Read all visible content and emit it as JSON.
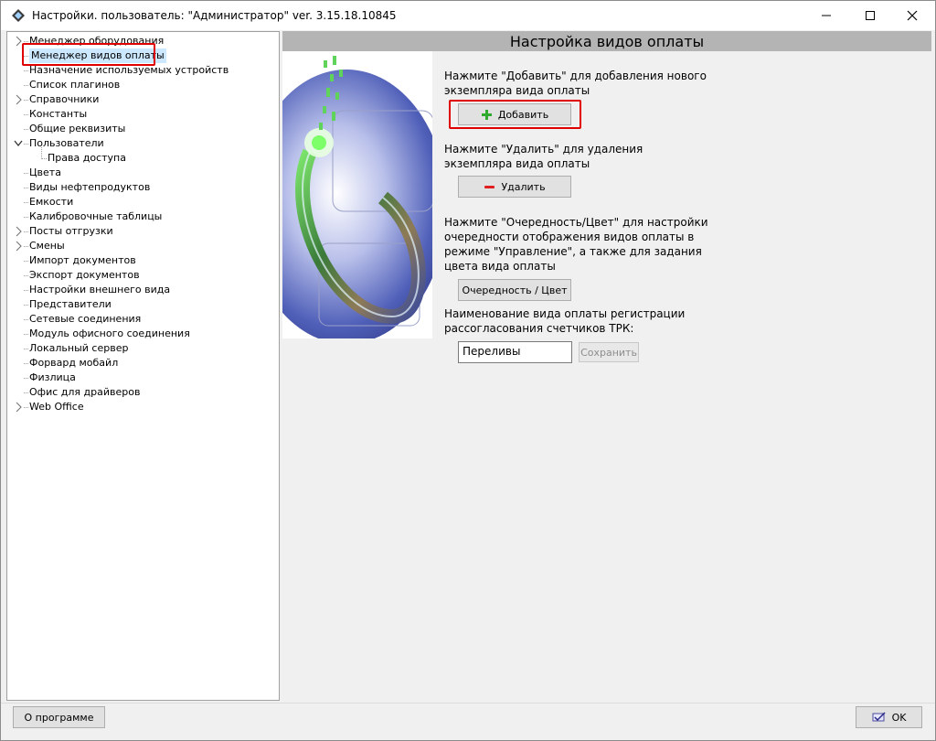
{
  "window": {
    "title": "Настройки. пользователь: \"Администратор\" ver. 3.15.18.10845"
  },
  "tree": {
    "items": [
      {
        "label": "Менеджер оборудования",
        "expandable": true,
        "expanded": false,
        "level": 0
      },
      {
        "label": "Менеджер видов оплаты",
        "expandable": false,
        "level": 0,
        "selected": true
      },
      {
        "label": "Назначение используемых устройств",
        "expandable": false,
        "level": 0
      },
      {
        "label": "Список плагинов",
        "expandable": false,
        "level": 0
      },
      {
        "label": "Справочники",
        "expandable": true,
        "expanded": false,
        "level": 0
      },
      {
        "label": "Константы",
        "expandable": false,
        "level": 0
      },
      {
        "label": "Общие реквизиты",
        "expandable": false,
        "level": 0
      },
      {
        "label": "Пользователи",
        "expandable": true,
        "expanded": true,
        "level": 0
      },
      {
        "label": "Права доступа",
        "expandable": false,
        "level": 1
      },
      {
        "label": "Цвета",
        "expandable": false,
        "level": 0
      },
      {
        "label": "Виды нефтепродуктов",
        "expandable": false,
        "level": 0
      },
      {
        "label": "Емкости",
        "expandable": false,
        "level": 0
      },
      {
        "label": "Калибровочные таблицы",
        "expandable": false,
        "level": 0
      },
      {
        "label": "Посты отгрузки",
        "expandable": true,
        "expanded": false,
        "level": 0
      },
      {
        "label": "Смены",
        "expandable": true,
        "expanded": false,
        "level": 0
      },
      {
        "label": "Импорт документов",
        "expandable": false,
        "level": 0
      },
      {
        "label": "Экспорт документов",
        "expandable": false,
        "level": 0
      },
      {
        "label": "Настройки внешнего вида",
        "expandable": false,
        "level": 0
      },
      {
        "label": "Представители",
        "expandable": false,
        "level": 0
      },
      {
        "label": "Сетевые соединения",
        "expandable": false,
        "level": 0
      },
      {
        "label": "Модуль офисного соединения",
        "expandable": false,
        "level": 0
      },
      {
        "label": "Локальный сервер",
        "expandable": false,
        "level": 0
      },
      {
        "label": "Форвард мобайл",
        "expandable": false,
        "level": 0
      },
      {
        "label": "Физлица",
        "expandable": false,
        "level": 0
      },
      {
        "label": "Офис для драйверов",
        "expandable": false,
        "level": 0
      },
      {
        "label": "Web Office",
        "expandable": true,
        "expanded": false,
        "level": 0
      }
    ]
  },
  "panel": {
    "header": "Настройка видов оплаты",
    "add_hint": "Нажмите \"Добавить\" для добавления нового экземпляра вида оплаты",
    "add_button": "Добавить",
    "delete_hint": "Нажмите \"Удалить\" для удаления экземпляра вида оплаты",
    "delete_button": "Удалить",
    "order_hint": "Нажмите \"Очередность/Цвет\" для настройки очередности отображения видов оплаты в режиме \"Управление\", а также для задания цвета вида оплаты",
    "order_button": "Очередность / Цвет",
    "name_hint": "Наименование вида оплаты регистрации рассогласования счетчиков ТРК:",
    "name_value": "Переливы",
    "save_button": "Сохранить"
  },
  "footer": {
    "about_button": "О программе",
    "ok_button": "OK"
  },
  "colors": {
    "header_bar": "#b4b4b4",
    "highlight": "#e00000",
    "plus_icon": "#2eaa2e",
    "minus_icon": "#e02020"
  }
}
